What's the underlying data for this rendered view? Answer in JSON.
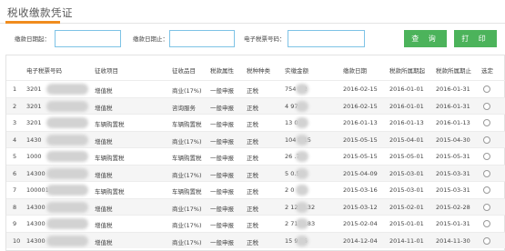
{
  "page": {
    "title": "税收缴款凭证"
  },
  "filters": {
    "start_date_label": "缴款日期起：",
    "end_date_label": "缴款日期止：",
    "ticket_no_label": "电子税票号码：",
    "start_date_value": "",
    "end_date_value": "",
    "ticket_no_value": "",
    "query_label": "查 询",
    "print_label": "打 印"
  },
  "table": {
    "headers": [
      "",
      "电子税票号码",
      "征收项目",
      "征收品目",
      "税款属性",
      "税种种类",
      "实缴金额",
      "缴款日期",
      "税款所属期起",
      "税款所属期止",
      "选定"
    ],
    "rows": [
      {
        "no": "1",
        "ticket": "3201",
        "item": "增值税",
        "category": "商业(17%)",
        "attr": "一般申报",
        "kind": "正税",
        "amount": "754  .32",
        "pay_date": "2016-02-15",
        "from": "2016-01-01",
        "to": "2016-01-31"
      },
      {
        "no": "2",
        "ticket": "3201",
        "item": "增值税",
        "category": "咨询服务",
        "attr": "一般申报",
        "kind": "正税",
        "amount": "4   97",
        "pay_date": "2016-02-15",
        "from": "2016-01-01",
        "to": "2016-01-31"
      },
      {
        "no": "3",
        "ticket": "3201",
        "item": "车辆购置税",
        "category": "车辆购置税",
        "attr": "一般申报",
        "kind": "正税",
        "amount": "13   0",
        "pay_date": "2016-01-13",
        "from": "2016-01-13",
        "to": "2016-01-13"
      },
      {
        "no": "4",
        "ticket": "1430",
        "item": "增值税",
        "category": "商业(17%)",
        "attr": "一般申报",
        "kind": "正税",
        "amount": "104  8.15",
        "pay_date": "2015-05-15",
        "from": "2015-04-01",
        "to": "2015-04-30"
      },
      {
        "no": "5",
        "ticket": "1000",
        "item": "车辆购置税",
        "category": "车辆购置税",
        "attr": "一般申报",
        "kind": "正税",
        "amount": "26   .74",
        "pay_date": "2015-05-15",
        "from": "2015-05-01",
        "to": "2015-05-31"
      },
      {
        "no": "6",
        "ticket": "14300",
        "item": "增值税",
        "category": "商业(17%)",
        "attr": "一般申报",
        "kind": "正税",
        "amount": "5   0.58",
        "pay_date": "2015-04-09",
        "from": "2015-03-01",
        "to": "2015-03-31"
      },
      {
        "no": "7",
        "ticket": "100001",
        "item": "车辆购置税",
        "category": "车辆购置税",
        "attr": "一般申报",
        "kind": "正税",
        "amount": "2   0",
        "pay_date": "2015-03-16",
        "from": "2015-03-01",
        "to": "2015-03-31"
      },
      {
        "no": "8",
        "ticket": "14300",
        "item": "增值税",
        "category": "商业(17%)",
        "attr": "一般申报",
        "kind": "正税",
        "amount": "2  1212.32",
        "pay_date": "2015-03-12",
        "from": "2015-02-01",
        "to": "2015-02-28"
      },
      {
        "no": "9",
        "ticket": "14300",
        "item": "增值税",
        "category": "商业(17%)",
        "attr": "一般申报",
        "kind": "正税",
        "amount": "2  7171.83",
        "pay_date": "2015-02-04",
        "from": "2015-01-01",
        "to": "2015-01-31"
      },
      {
        "no": "10",
        "ticket": "14300",
        "item": "增值税",
        "category": "商业(17%)",
        "attr": "一般申报",
        "kind": "正税",
        "amount": "15   9.56",
        "pay_date": "2014-12-04",
        "from": "2014-11-01",
        "to": "2014-11-30"
      }
    ]
  }
}
